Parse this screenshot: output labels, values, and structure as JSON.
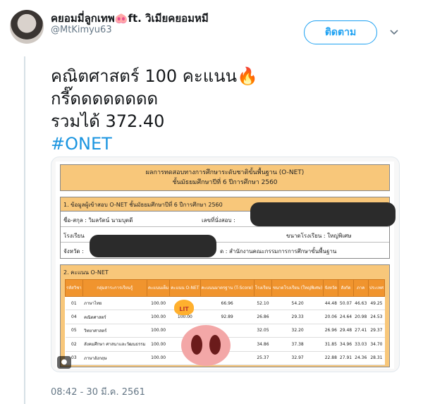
{
  "tweet": {
    "display_name": "คยอมมี่ลูกเทพ🐽ft. วิเมียคยอมหมี",
    "handle": "@MtKimyu63",
    "follow_label": "ติดตาม",
    "text_line1": "คณิตศาสตร์ 100 คะแนน🔥",
    "text_line2": "กรี๊ดดดดดดดด",
    "text_line3": "รวมได้ 372.40",
    "hashtag": "#ONET",
    "timestamp": "08:42 - 30 มี.ค. 2561"
  },
  "sheet": {
    "title_line1": "ผลการทดสอบทางการศึกษาระดับชาติขั้นพื้นฐาน (O-NET)",
    "title_line2": "ชั้นมัธยมศึกษาปีที่ 6  ปีการศึกษา  2560",
    "info_header": "1. ข้อมูลผู้เข้าสอบ  O-NET  ชั้นมัธยมศึกษาปีที่ 6  ปีการศึกษา  2560",
    "name_label": "ชื่อ-สกุล : วิมลรัตน์ นามบุตดี",
    "seat_label": "เลขที่นั่งสอบ :",
    "school_label": "โรงเรียน",
    "school_size": "ขนาดโรงเรียน : ใหญ่พิเศษ",
    "province_label": "จังหวัด :",
    "office_label": "ด : สำนักงานคณะกรรมการการศึกษาขั้นพื้นฐาน",
    "score_header": "2. คะแนน  O-NET",
    "col_headers": [
      "รหัสวิชา",
      "กลุ่มสาระการเรียนรู้",
      "คะแนนเต็ม",
      "คะแนน O-NET",
      "คะแนนมาตรฐาน (T-Score)",
      "โรงเรียน",
      "ขนาดโรงเรียน (ใหญ่พิเศษ)",
      "จังหวัด",
      "สังกัด",
      "ภาค",
      "ประเทศ"
    ],
    "avg_header": "คะแนนเฉลี่ยจำแนกตามระดับ",
    "rows": [
      {
        "code": "01",
        "subject": "ภาษาไทย",
        "full": "100.00",
        "score": "",
        "tscore": "66.96",
        "school": "52.10",
        "size": "54.20",
        "province": "44.48",
        "affil": "50.07",
        "region": "46.63",
        "nation": "49.25"
      },
      {
        "code": "04",
        "subject": "คณิตศาสตร์",
        "full": "100.00",
        "score": "100.00",
        "tscore": "92.89",
        "school": "26.86",
        "size": "29.33",
        "province": "20.06",
        "affil": "24.64",
        "region": "20.98",
        "nation": "24.53"
      },
      {
        "code": "05",
        "subject": "วิทยาศาสตร์",
        "full": "100.00",
        "score": "",
        "tscore": "",
        "school": "32.05",
        "size": "32.20",
        "province": "26.96",
        "affil": "29.48",
        "region": "27.41",
        "nation": "29.37"
      },
      {
        "code": "02",
        "subject": "สังคมศึกษา ศาสนาและวัฒนธรรม",
        "full": "100.00",
        "score": "",
        "tscore": "",
        "school": "34.86",
        "size": "37.38",
        "province": "31.85",
        "affil": "34.96",
        "region": "33.03",
        "nation": "34.70"
      },
      {
        "code": "03",
        "subject": "ภาษาอังกฤษ",
        "full": "100.00",
        "score": "",
        "tscore": "",
        "school": "25.37",
        "size": "32.97",
        "province": "22.88",
        "affil": "27.91",
        "region": "24.36",
        "nation": "28.31"
      }
    ],
    "lit_label": "LIT"
  },
  "icons": {
    "chevron": "chevron-down-icon",
    "media_tag": "tag-icon"
  }
}
